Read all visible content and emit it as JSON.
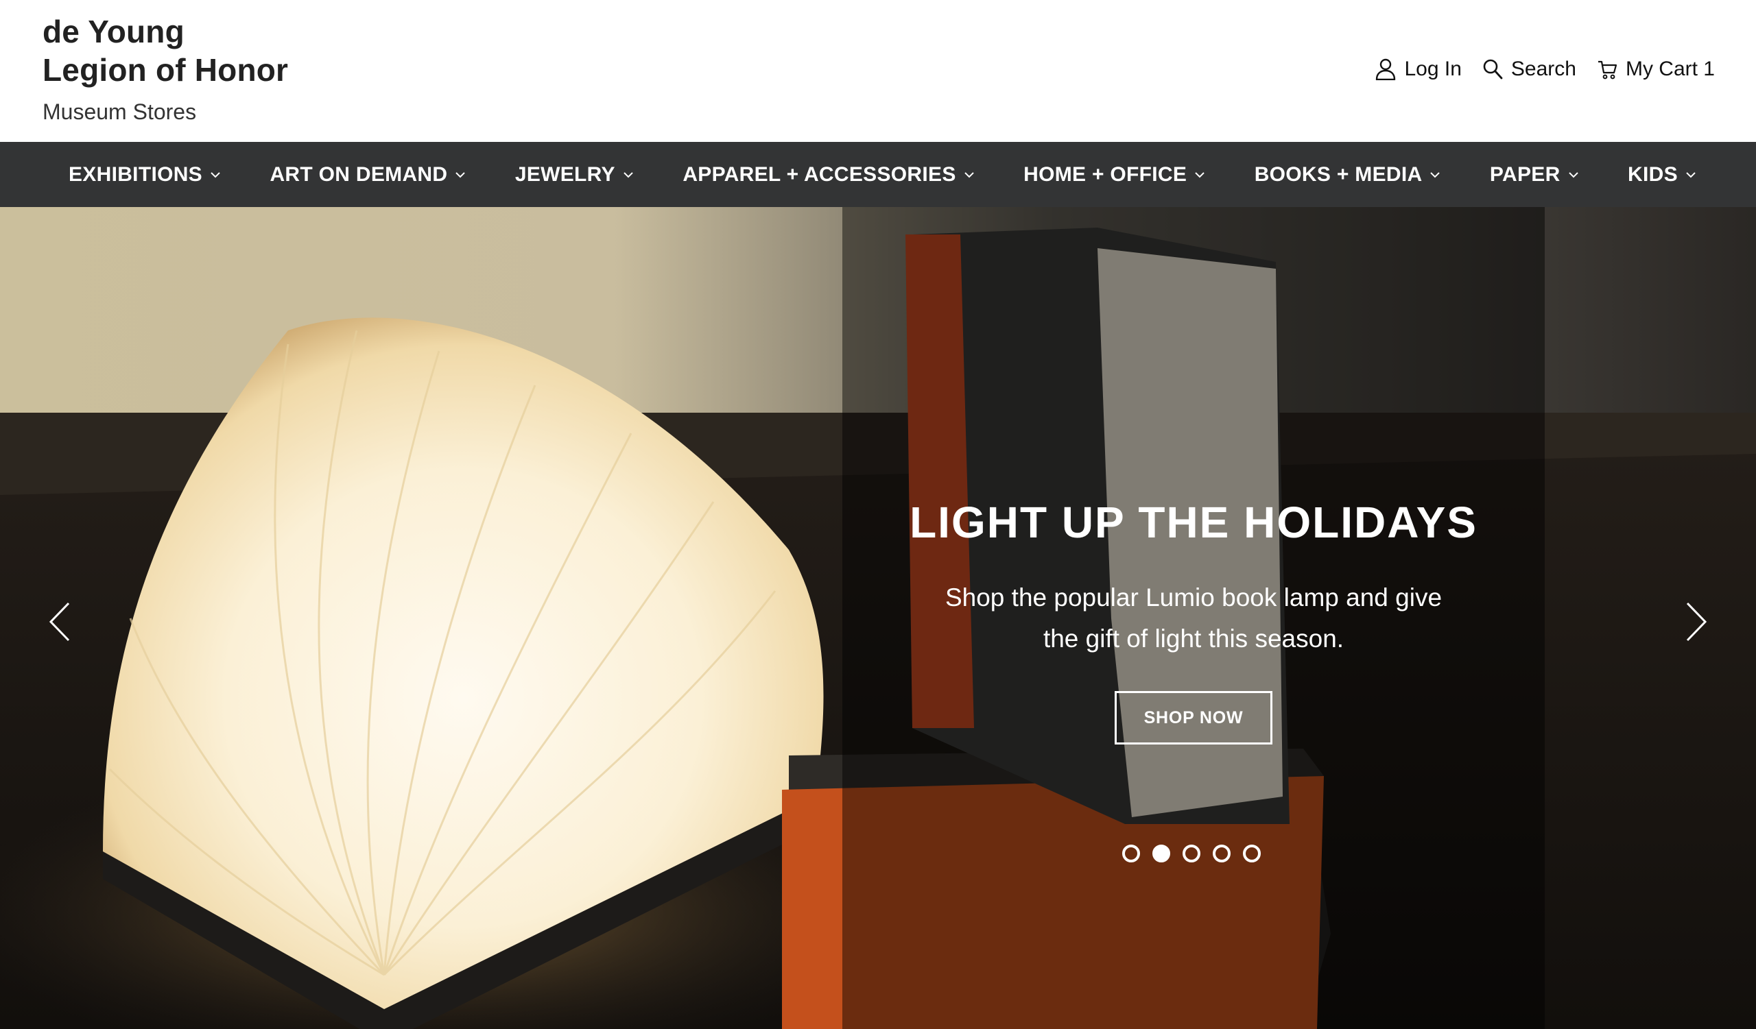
{
  "brand": {
    "line1": "de Young",
    "line2": "Legion of Honor",
    "subtitle": "Museum Stores"
  },
  "utility": {
    "login": {
      "label": "Log In",
      "icon": "user-icon"
    },
    "search": {
      "label": "Search",
      "icon": "search-icon"
    },
    "cart": {
      "label": "My Cart 1",
      "icon": "cart-icon"
    }
  },
  "nav": {
    "items": [
      {
        "label": "EXHIBITIONS"
      },
      {
        "label": "ART ON DEMAND"
      },
      {
        "label": "JEWELRY"
      },
      {
        "label": "APPAREL + ACCESSORIES"
      },
      {
        "label": "HOME + OFFICE"
      },
      {
        "label": "BOOKS + MEDIA"
      },
      {
        "label": "PAPER"
      },
      {
        "label": "KIDS"
      }
    ]
  },
  "hero": {
    "title": "LIGHT UP THE HOLIDAYS",
    "text": "Shop the popular Lumio book lamp and give the gift of light this season.",
    "button": "SHOP NOW",
    "slide_count": 5,
    "active_slide": 2
  },
  "colors": {
    "nav_background": "#333435",
    "header_background": "#ffffff",
    "text_dark": "#222222"
  }
}
